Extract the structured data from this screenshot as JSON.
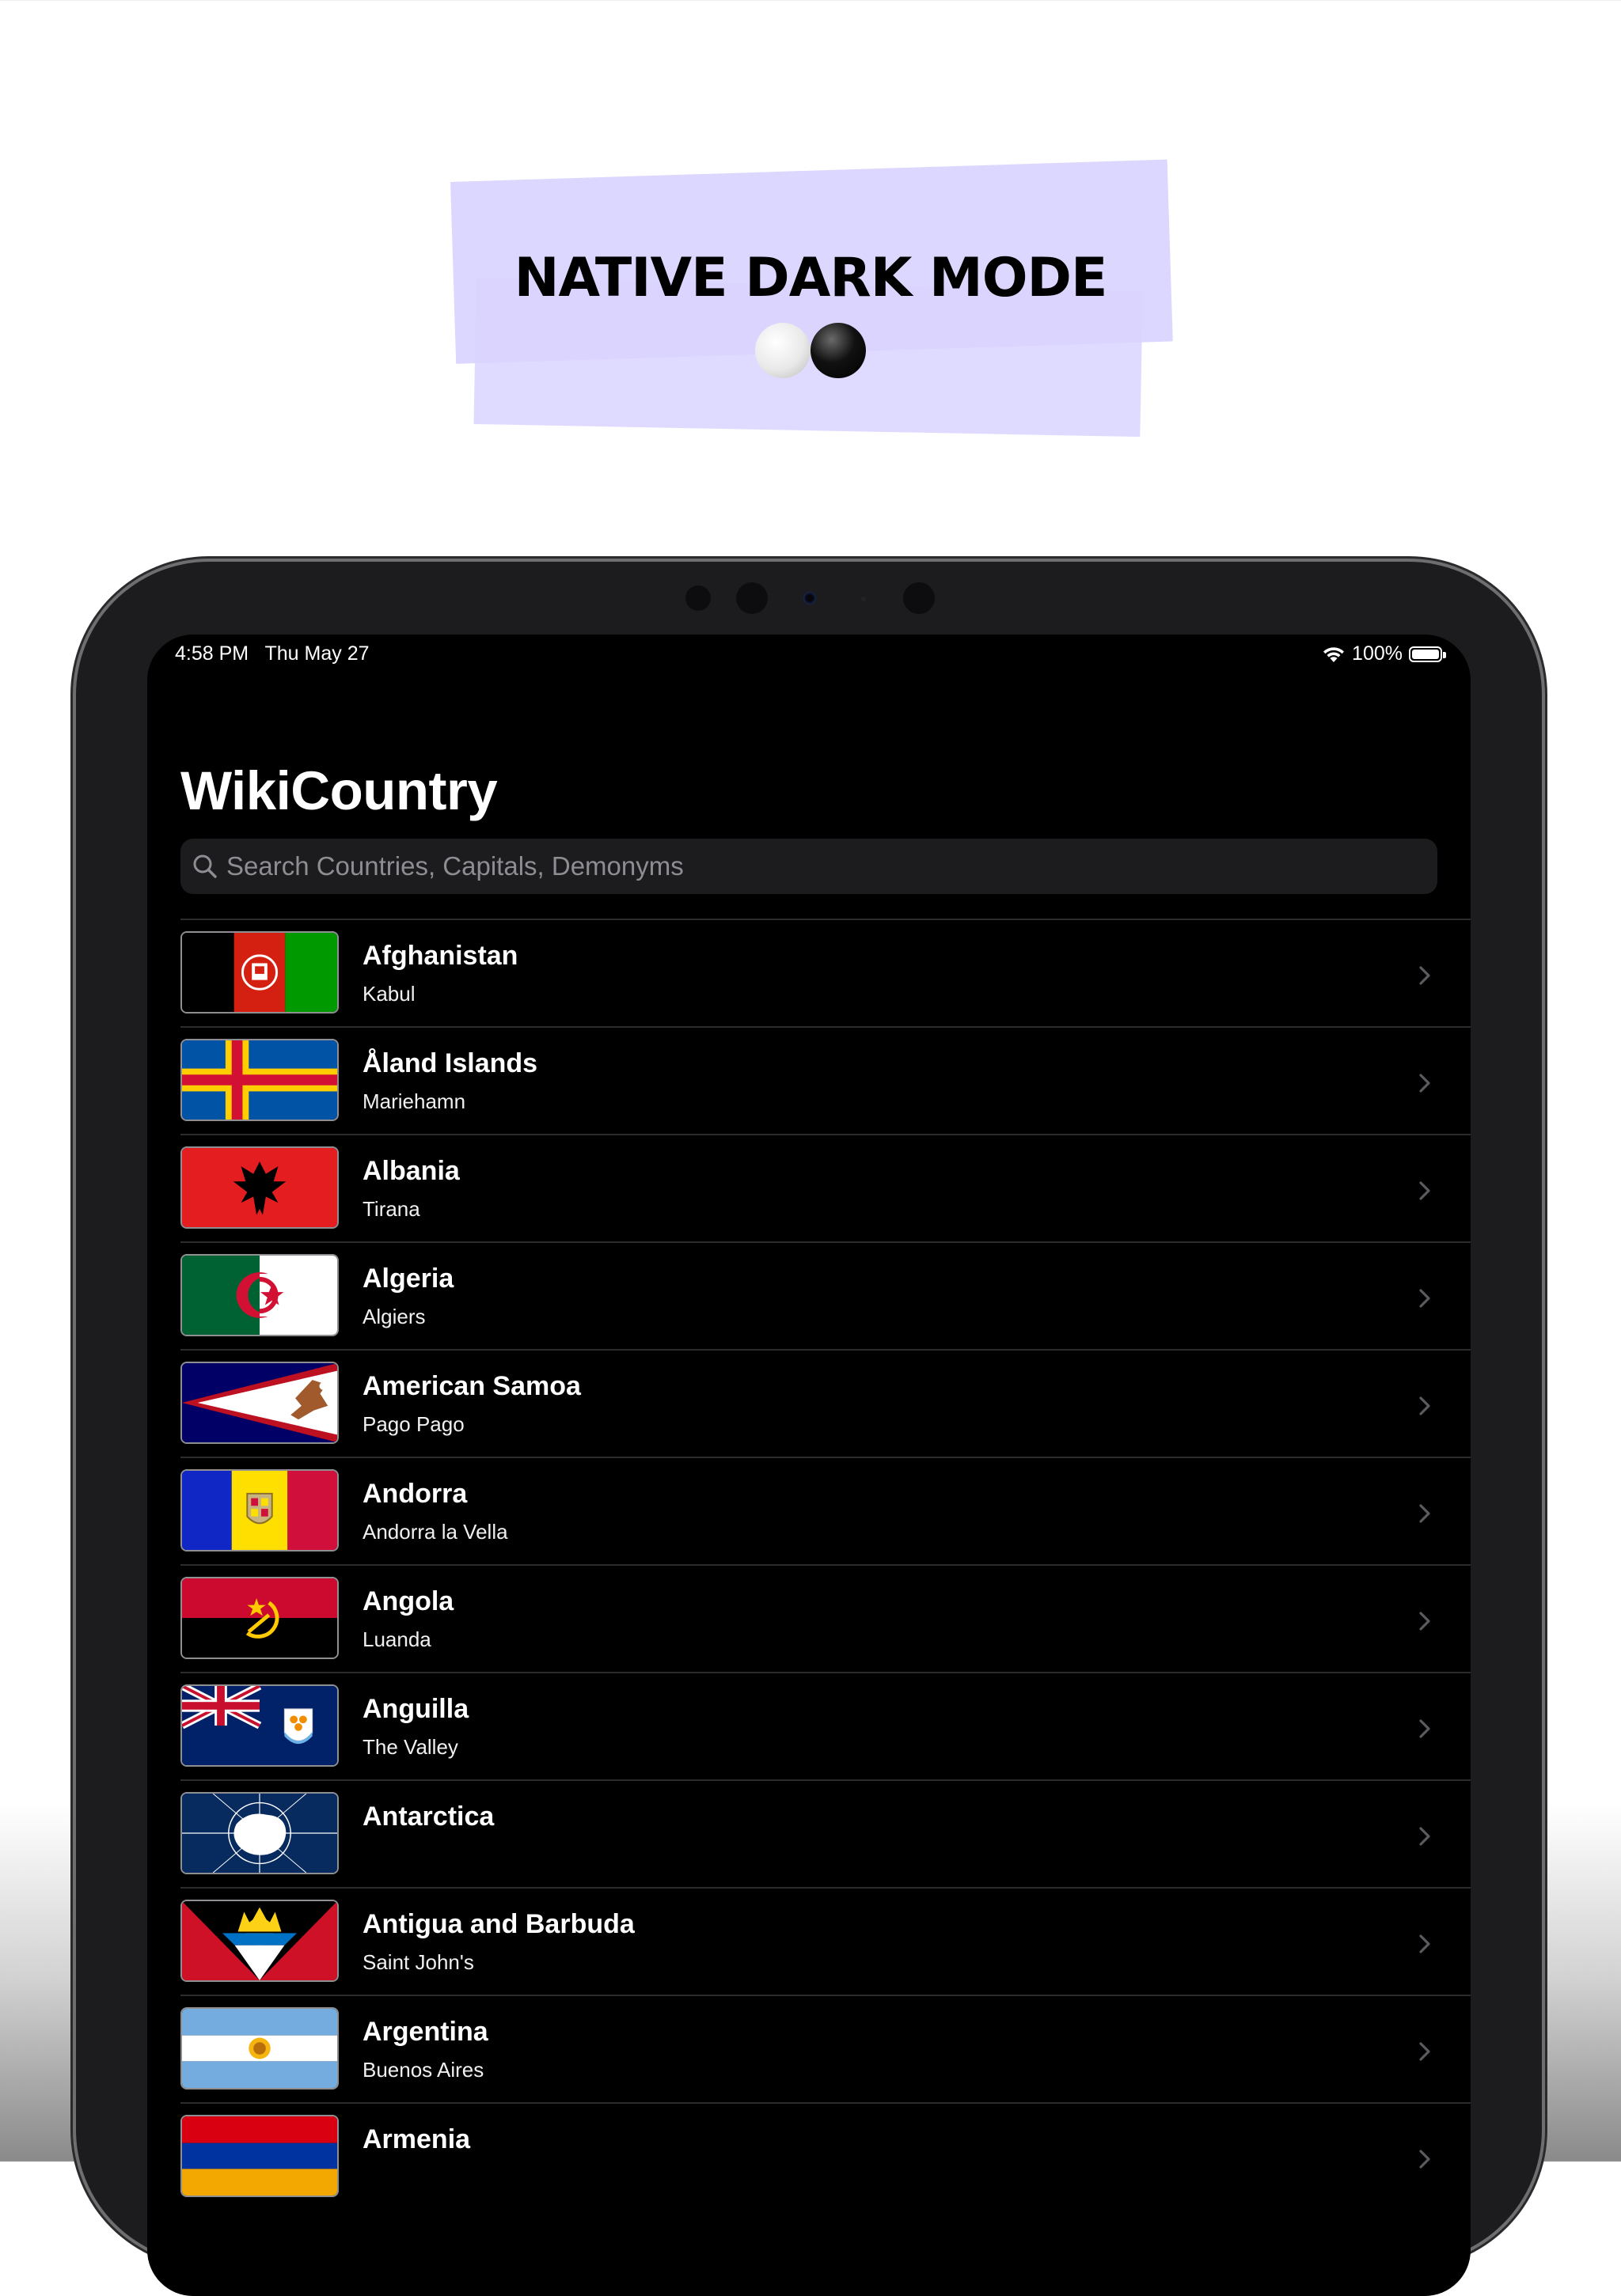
{
  "banner": {
    "headline": "NATIVE DARK MODE",
    "highlight_color": "#d9d4ff"
  },
  "status_bar": {
    "time": "4:58 PM",
    "date": "Thu May 27",
    "battery": "100%",
    "battery_level": 1.0
  },
  "app": {
    "title": "WikiCountry",
    "search_placeholder": "Search Countries, Capitals, Demonyms"
  },
  "countries": [
    {
      "name": "Afghanistan",
      "capital": "Kabul",
      "flag_icon": "afghanistan-flag-icon"
    },
    {
      "name": "Åland Islands",
      "capital": "Mariehamn",
      "flag_icon": "aland-islands-flag-icon"
    },
    {
      "name": "Albania",
      "capital": "Tirana",
      "flag_icon": "albania-flag-icon"
    },
    {
      "name": "Algeria",
      "capital": "Algiers",
      "flag_icon": "algeria-flag-icon"
    },
    {
      "name": "American Samoa",
      "capital": "Pago Pago",
      "flag_icon": "american-samoa-flag-icon"
    },
    {
      "name": "Andorra",
      "capital": "Andorra la Vella",
      "flag_icon": "andorra-flag-icon"
    },
    {
      "name": "Angola",
      "capital": "Luanda",
      "flag_icon": "angola-flag-icon"
    },
    {
      "name": "Anguilla",
      "capital": "The Valley",
      "flag_icon": "anguilla-flag-icon"
    },
    {
      "name": "Antarctica",
      "capital": "",
      "flag_icon": "antarctica-flag-icon"
    },
    {
      "name": "Antigua and Barbuda",
      "capital": "Saint John's",
      "flag_icon": "antigua-and-barbuda-flag-icon"
    },
    {
      "name": "Argentina",
      "capital": "Buenos Aires",
      "flag_icon": "argentina-flag-icon"
    },
    {
      "name": "Armenia",
      "capital": "",
      "flag_icon": "armenia-flag-icon"
    }
  ]
}
